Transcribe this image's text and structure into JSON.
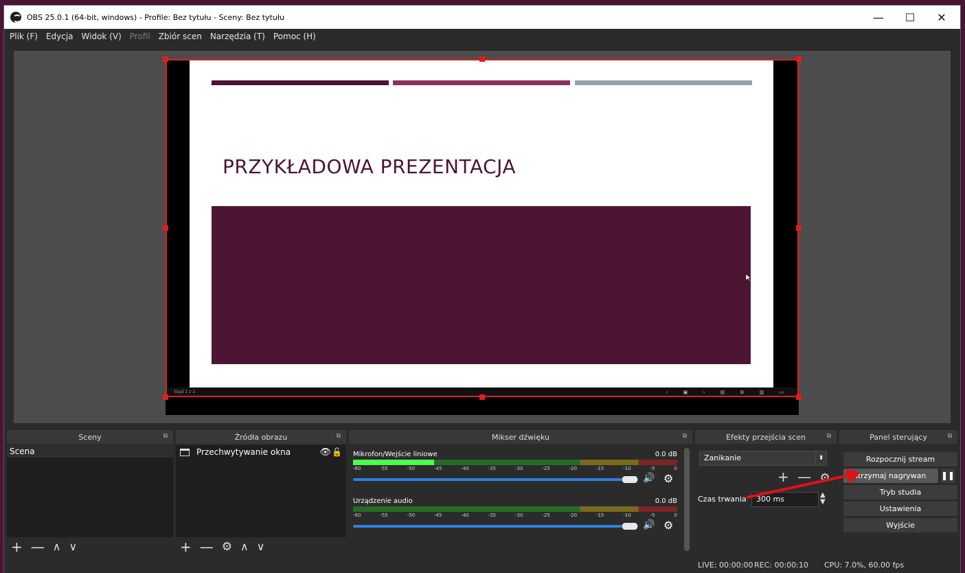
{
  "window": {
    "title": "OBS 25.0.1 (64-bit, windows) - Profile: Bez tytułu - Sceny: Bez tytułu",
    "controls": {
      "minimize": "—",
      "maximize": "☐",
      "close": "✕"
    }
  },
  "menu": [
    "Plik (F)",
    "Edycja",
    "Widok (V)",
    "Profil",
    "Zbiór scen",
    "Narzędzia (T)",
    "Pomoc (H)"
  ],
  "menu_disabled": "Profil",
  "preview": {
    "slide_title": "PRZYKŁADOWA PREZENTACJA",
    "slide_info": "Slajd 1 z 2",
    "slide_controls": "‹ ▣ › ▤ ⊞ ▥ ▭"
  },
  "docks": {
    "scenes": {
      "title": "Sceny",
      "items": [
        "Scena"
      ]
    },
    "sources": {
      "title": "Źródła obrazu",
      "items": [
        "Przechwytywanie okna"
      ]
    },
    "mixer": {
      "title": "Mikser dźwięku",
      "tracks": [
        {
          "name": "Mikrofon/Wejście liniowe",
          "db": "0.0 dB",
          "level": 0.25
        },
        {
          "name": "Urządzenie audio",
          "db": "0.0 dB",
          "level": 0
        }
      ],
      "scale": [
        "-60",
        "-55",
        "-50",
        "-45",
        "-40",
        "-35",
        "-30",
        "-25",
        "-20",
        "-15",
        "-10",
        "-5",
        "0"
      ]
    },
    "transitions": {
      "title": "Efekty przejścia scen",
      "selected": "Zanikanie",
      "duration_label": "Czas trwania",
      "duration_value": "300 ms"
    },
    "controls": {
      "title": "Panel sterujący",
      "start_stream": "Rozpocznij stream",
      "stop_recording": "ıtrzymaj nagrywan",
      "studio_mode": "Tryb studia",
      "settings": "Ustawienia",
      "exit": "Wyjście"
    }
  },
  "status": {
    "live": "LIVE: 00:00:00",
    "rec": "REC: 00:00:10",
    "cpu": "CPU: 7.0%, 60.00 fps"
  },
  "colors": {
    "selection": "#e01e1e",
    "slide_primary": "#4b1432",
    "slide_secondary": "#8c2f5f",
    "slide_gray": "#9aa1ad",
    "fader": "#2d7fe0"
  }
}
